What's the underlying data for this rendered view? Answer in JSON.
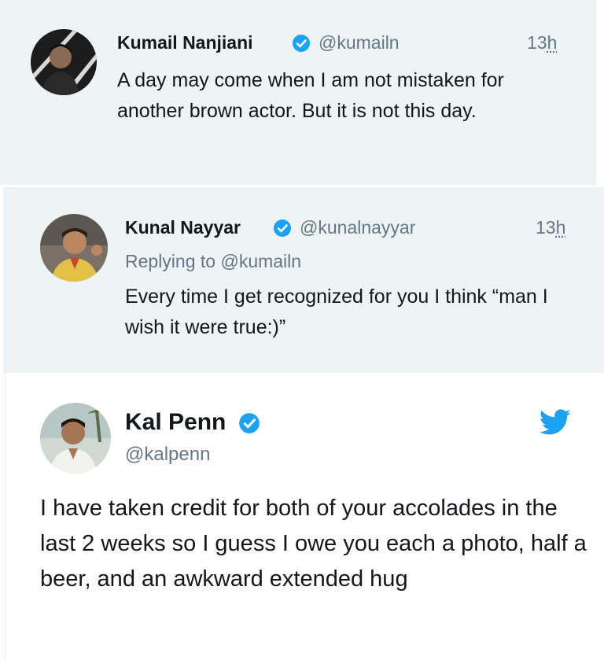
{
  "colors": {
    "verified_blue": "#1da1f2",
    "twitter_blue": "#1da1f2",
    "reply_background": "#eef3f6",
    "secondary_text": "#657786"
  },
  "tweets": [
    {
      "name": "Kumail Nanjiani",
      "verified": true,
      "handle": "@kumailn",
      "time_number": "13",
      "time_unit": "h",
      "text": "A day may come when I am not mistaken for another brown actor. But it is not this day."
    },
    {
      "name": "Kunal Nayyar",
      "verified": true,
      "handle": "@kunalnayyar",
      "time_number": "13",
      "time_unit": "h",
      "replying_prefix": "Replying to",
      "replying_to": "@kumailn",
      "text": "Every time I get recognized for you I think “man I wish it were true:)”"
    },
    {
      "name": "Kal Penn",
      "verified": true,
      "handle": "@kalpenn",
      "brand_icon": "twitter-bird-icon",
      "text": "I have taken credit for both of your accolades in the last 2 weeks so I guess I owe you each a photo, half a beer, and an awkward extended hug"
    }
  ]
}
